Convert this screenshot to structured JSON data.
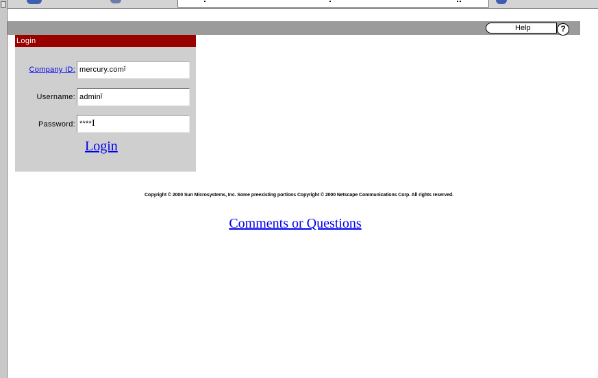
{
  "header": {
    "help_label": "Help",
    "help_icon": "?"
  },
  "login": {
    "title": "Login",
    "company_label": "Company ID:",
    "company_value": "mercury.com",
    "username_label": "Username:",
    "username_value": "admin",
    "password_label": "Password:",
    "password_value": "****",
    "login_link": "Login"
  },
  "footer": {
    "copyright": "Copyright © 2000 Sun Microsystems, Inc. Some preexisting portions Copyright © 2000 Netscape Communications Corp. All rights reserved.",
    "comments_link": "Comments or Questions"
  },
  "colors": {
    "login_header": "#990000",
    "panel": "#cfcfcf",
    "topbar": "#9b9b9b",
    "link": "#0000ee"
  }
}
